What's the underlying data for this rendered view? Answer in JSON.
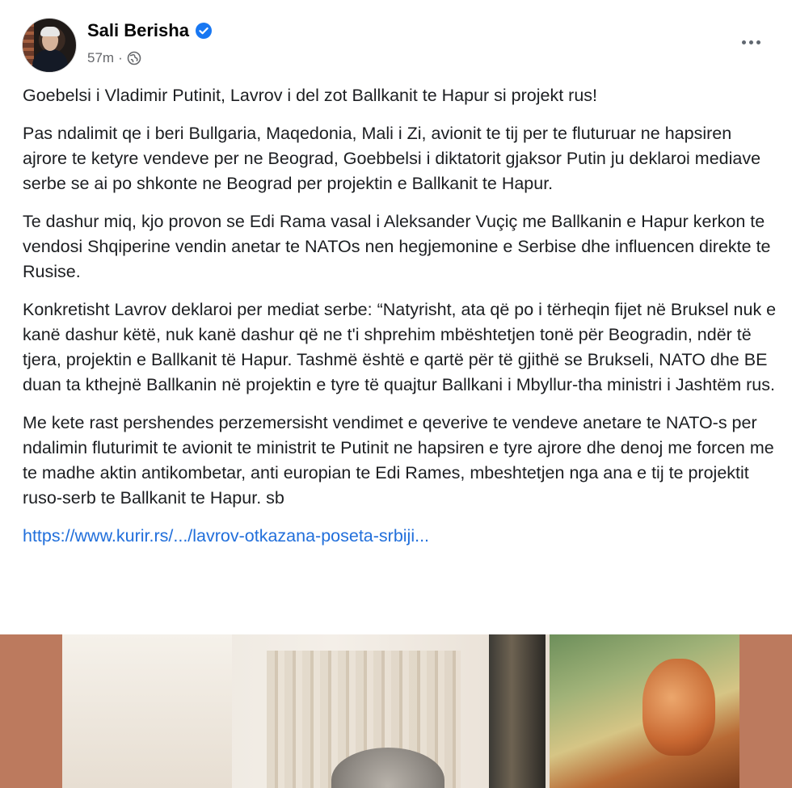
{
  "author": {
    "name": "Sali Berisha",
    "verified": true,
    "time": "57m",
    "separator": "·",
    "audience_icon": "globe-icon"
  },
  "actions": {
    "more_icon": "more-horizontal-icon"
  },
  "post": {
    "paragraphs": [
      "Goebelsi i Vladimir Putinit, Lavrov i del zot  Ballkanit te Hapur si projekt rus!",
      "Pas ndalimit qe i beri Bullgaria, Maqedonia, Mali i Zi, avionit te tij per te fluturuar ne hapsiren ajrore te ketyre vendeve per ne Beograd, Goebbelsi i diktatorit gjaksor Putin ju deklaroi mediave serbe se ai po shkonte ne Beograd per projektin e Ballkanit te Hapur.",
      "Te dashur miq, kjo provon se Edi Rama vasal i Aleksander Vuçiç me Ballkanin e Hapur kerkon te vendosi Shqiperine vendin anetar te NATOs nen hegjemonine e Serbise dhe influencen direkte te Rusise.",
      "Konkretisht Lavrov deklaroi per mediat serbe: “Natyrisht, ata që po i tërheqin fijet në Bruksel nuk e kanë dashur këtë, nuk kanë dashur që ne t'i shprehim mbështetjen tonë për Beogradin, ndër të tjera, projektin e Ballkanit të Hapur. Tashmë është e qartë për të gjithë se Brukseli, NATO dhe BE duan ta kthejnë Ballkanin në projektin e tyre të quajtur Ballkani i Mbyllur-tha ministri i Jashtëm rus.",
      "Me kete rast pershendes perzemersisht vendimet e qeverive te vendeve anetare te NATO-s per ndalimin fluturimit te avionit te ministrit te Putinit ne hapsiren e tyre ajrore dhe denoj me forcen me te madhe aktin antikombetar, anti europian te Edi Rames, mbeshtetjen nga ana e tij te projektit ruso-serb te Ballkanit te Hapur. sb"
    ],
    "link_text": "https://www.kurir.rs/.../lavrov-otkazana-poseta-srbiji..."
  },
  "colors": {
    "verified": "#1877f2",
    "link": "#216fdb",
    "meta": "#65676b",
    "media_border": "#bc7a5e"
  }
}
